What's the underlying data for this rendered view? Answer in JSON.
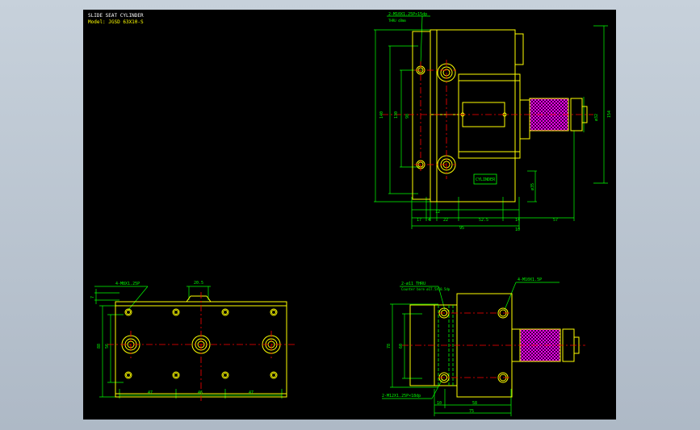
{
  "title_block": {
    "line1": "SLIDE SEAT CYLINDER",
    "line2": "Model: JGSD 63X10-S"
  },
  "colors": {
    "background": "#000000",
    "frame": "#ffffff",
    "outline": "#ffff00",
    "dimension": "#00ff00",
    "centerline": "#ff0000",
    "hidden": "#00ff00",
    "knurl": "#ff00ff",
    "cyan_text": "#00ffff"
  },
  "views": {
    "top_right": {
      "callout_holes": "2-M10X1.25P×15dp",
      "callout_holes_note": "THRU ¢Bmm",
      "nameplate": "CYLINDER",
      "dims_vertical_left": [
        "140",
        "130",
        "98"
      ],
      "dims_vertical_right": [
        "ø32",
        "154"
      ],
      "dim_gap": "ø35",
      "dims_bottom_row": [
        "17",
        "4",
        "22",
        "52.5",
        "14",
        "57"
      ],
      "dim_small": "12",
      "dim_small2": "10",
      "dim_total": "95"
    },
    "bottom_left": {
      "callout": "4-M8X1.25P",
      "dim_top": "20.5",
      "dim_left_small": "7",
      "dims_vertical": [
        "88",
        "56"
      ],
      "dims_bottom": [
        "47",
        "46",
        "47"
      ]
    },
    "bottom_right": {
      "callout_top_left": "2-ø11 THRU",
      "callout_top_left_note": "Counter bore ø17.5X10.5dp",
      "callout_top_right": "4-M10X1.5P",
      "dims_vertical": [
        "78",
        "60"
      ],
      "callout_bottom": "2-M12X1.25P×18dp",
      "dims_bottom": [
        "10",
        "58"
      ],
      "dim_total": "75"
    }
  }
}
